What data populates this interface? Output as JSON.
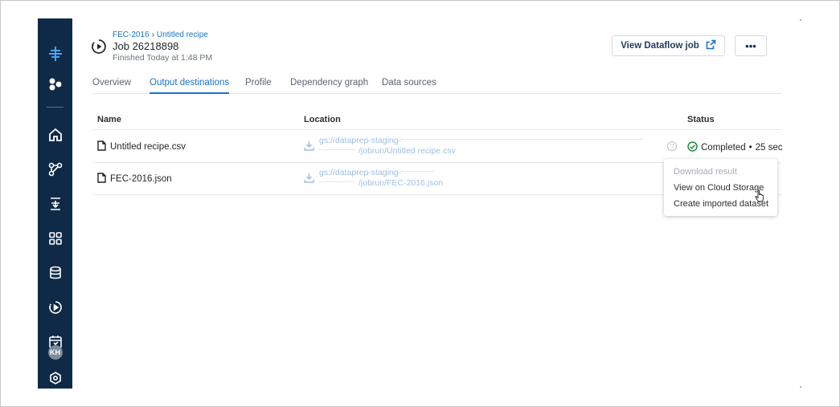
{
  "breadcrumb": {
    "first": "FEC-2016",
    "second": "Untitled recipe"
  },
  "job": {
    "title": "Job 26218898",
    "finished": "Finished Today at 1:48 PM"
  },
  "actions": {
    "view_dataflow_label": "View Dataflow job",
    "more_label": "•••"
  },
  "tabs": [
    {
      "label": "Overview"
    },
    {
      "label": "Output destinations"
    },
    {
      "label": "Profile"
    },
    {
      "label": "Dependency graph"
    },
    {
      "label": "Data sources"
    }
  ],
  "table": {
    "headers": {
      "name": "Name",
      "location": "Location",
      "status": "Status"
    },
    "rows": [
      {
        "name": "Untitled recipe.csv",
        "location_line1": "gs://dataprep-staging-",
        "location_line2": "/jobrun/Untitled recipe.csv",
        "status": "Completed",
        "duration": "25 sec"
      },
      {
        "name": "FEC-2016.json",
        "location_line1": "gs://dataprep-staging-",
        "location_line2": "/jobrun/FEC-2016.json"
      }
    ]
  },
  "menu": {
    "items": [
      {
        "label": "Download result"
      },
      {
        "label": "View on Cloud Storage"
      },
      {
        "label": "Create imported dataset"
      }
    ]
  },
  "sidebar": {
    "avatar_initials": "KH"
  },
  "icons": {
    "logo": "dataprep-logo-icon",
    "flows": "flows-icon",
    "home": "home-icon",
    "flow": "flow-icon",
    "recipe": "recipe-icon",
    "apps": "apps-icon",
    "database": "database-icon",
    "jobs": "jobs-icon",
    "schedule": "schedule-icon",
    "settings": "settings-icon"
  },
  "colors": {
    "accent": "#1a73c9",
    "sidebar": "#0f2a47",
    "success": "#1e8e3e"
  }
}
